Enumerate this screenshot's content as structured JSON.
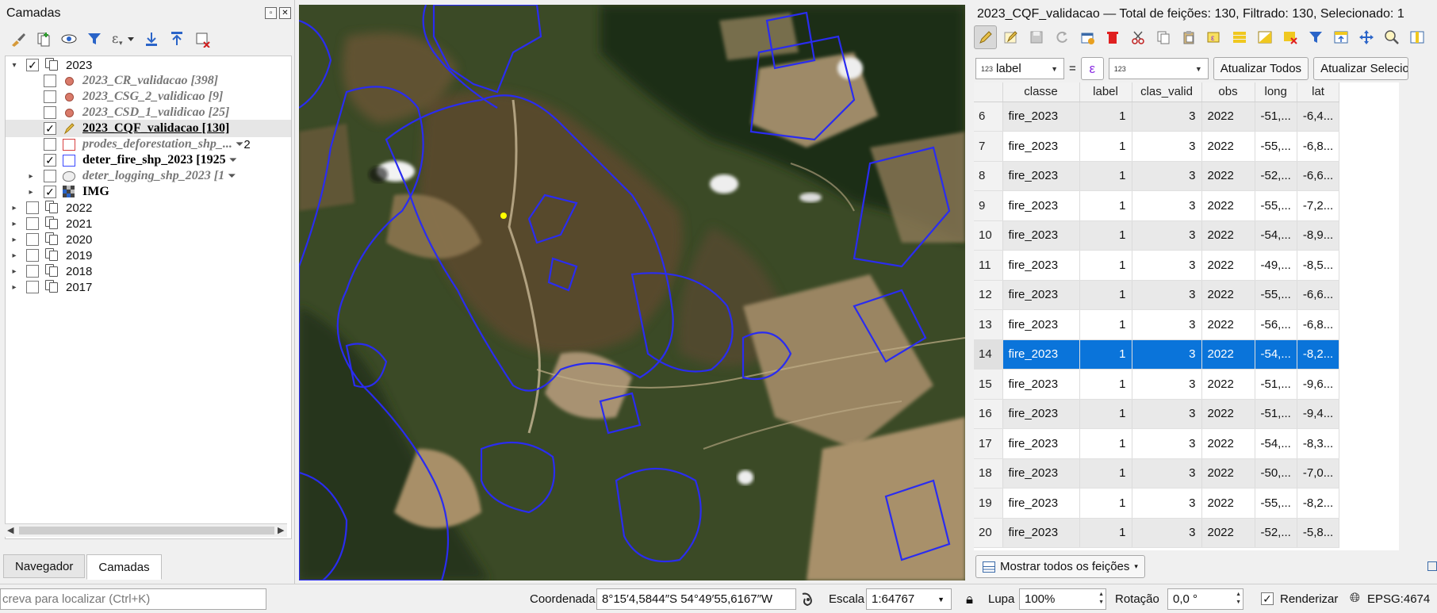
{
  "layers_panel": {
    "title": "Camadas",
    "tree": [
      {
        "label": "2023",
        "checked": "✓",
        "kind": "group",
        "expanded": true
      },
      {
        "label": "2023_CR_validacao [398]",
        "checked": "",
        "kind": "point"
      },
      {
        "label": "2023_CSG_2_validicao [9]",
        "checked": "",
        "kind": "point"
      },
      {
        "label": "2023_CSD_1_validicao [25]",
        "checked": "",
        "kind": "point"
      },
      {
        "label": "2023_CQF_validacao [130]",
        "checked": "✓",
        "kind": "edit"
      },
      {
        "label": "prodes_deforestation_shp_...",
        "checked": "",
        "kind": "poly-red",
        "suffix": "2"
      },
      {
        "label": "deter_fire_shp_2023 [1925",
        "checked": "✓",
        "kind": "poly-blue"
      },
      {
        "label": "deter_logging_shp_2023 [1",
        "checked": "",
        "kind": "poly-gray"
      },
      {
        "label": "IMG",
        "checked": "✓",
        "kind": "raster"
      },
      {
        "label": "2022",
        "checked": "",
        "kind": "group"
      },
      {
        "label": "2021",
        "checked": "",
        "kind": "group"
      },
      {
        "label": "2020",
        "checked": "",
        "kind": "group"
      },
      {
        "label": "2019",
        "checked": "",
        "kind": "group"
      },
      {
        "label": "2018",
        "checked": "",
        "kind": "group"
      },
      {
        "label": "2017",
        "checked": "",
        "kind": "group"
      }
    ],
    "tabs": [
      "Navegador",
      "Camadas"
    ]
  },
  "attribute_table": {
    "title": "2023_CQF_validacao — Total de feições: 130, Filtrado: 130, Selecionado: 1",
    "field_combo": "label",
    "field_type_tag": "123",
    "equals": "=",
    "value_combo": "123",
    "update_all": "Atualizar Todos",
    "update_selected": "Atualizar Selecio",
    "columns": [
      "classe",
      "label",
      "clas_valid",
      "obs",
      "long",
      "lat"
    ],
    "rows": [
      [
        "6",
        "fire_2023",
        "1",
        "3",
        "2022",
        "-51,...",
        "-6,4..."
      ],
      [
        "7",
        "fire_2023",
        "1",
        "3",
        "2022",
        "-55,...",
        "-6,8..."
      ],
      [
        "8",
        "fire_2023",
        "1",
        "3",
        "2022",
        "-52,...",
        "-6,6..."
      ],
      [
        "9",
        "fire_2023",
        "1",
        "3",
        "2022",
        "-55,...",
        "-7,2..."
      ],
      [
        "10",
        "fire_2023",
        "1",
        "3",
        "2022",
        "-54,...",
        "-8,9..."
      ],
      [
        "11",
        "fire_2023",
        "1",
        "3",
        "2022",
        "-49,...",
        "-8,5..."
      ],
      [
        "12",
        "fire_2023",
        "1",
        "3",
        "2022",
        "-55,...",
        "-6,6..."
      ],
      [
        "13",
        "fire_2023",
        "1",
        "3",
        "2022",
        "-56,...",
        "-6,8..."
      ],
      [
        "14",
        "fire_2023",
        "1",
        "3",
        "2022",
        "-54,...",
        "-8,2..."
      ],
      [
        "15",
        "fire_2023",
        "1",
        "3",
        "2022",
        "-51,...",
        "-9,6..."
      ],
      [
        "16",
        "fire_2023",
        "1",
        "3",
        "2022",
        "-51,...",
        "-9,4..."
      ],
      [
        "17",
        "fire_2023",
        "1",
        "3",
        "2022",
        "-54,...",
        "-8,3..."
      ],
      [
        "18",
        "fire_2023",
        "1",
        "3",
        "2022",
        "-50,...",
        "-7,0..."
      ],
      [
        "19",
        "fire_2023",
        "1",
        "3",
        "2022",
        "-55,...",
        "-8,2..."
      ],
      [
        "20",
        "fire_2023",
        "1",
        "3",
        "2022",
        "-52,...",
        "-5,8..."
      ]
    ],
    "selected_row": "14",
    "show_all": "Mostrar todos os feições"
  },
  "status_bar": {
    "search_placeholder": "crevа para localizar (Ctrl+K)",
    "coord_label": "Coordenada",
    "coord_value": "8°15′4,5844″S  54°49′55,6167″W",
    "scale_label": "Escala",
    "scale_value": "1:64767",
    "magnifier_label": "Lupa",
    "magnifier_value": "100%",
    "rotation_label": "Rotação",
    "rotation_value": "0,0 °",
    "render_label": "Renderizar",
    "render_checked": "✓",
    "crs": "EPSG:4674"
  },
  "colors": {
    "selection": "#0a74da",
    "fire_outline": "#2a2cf0",
    "selected_point": "#ffff00"
  }
}
